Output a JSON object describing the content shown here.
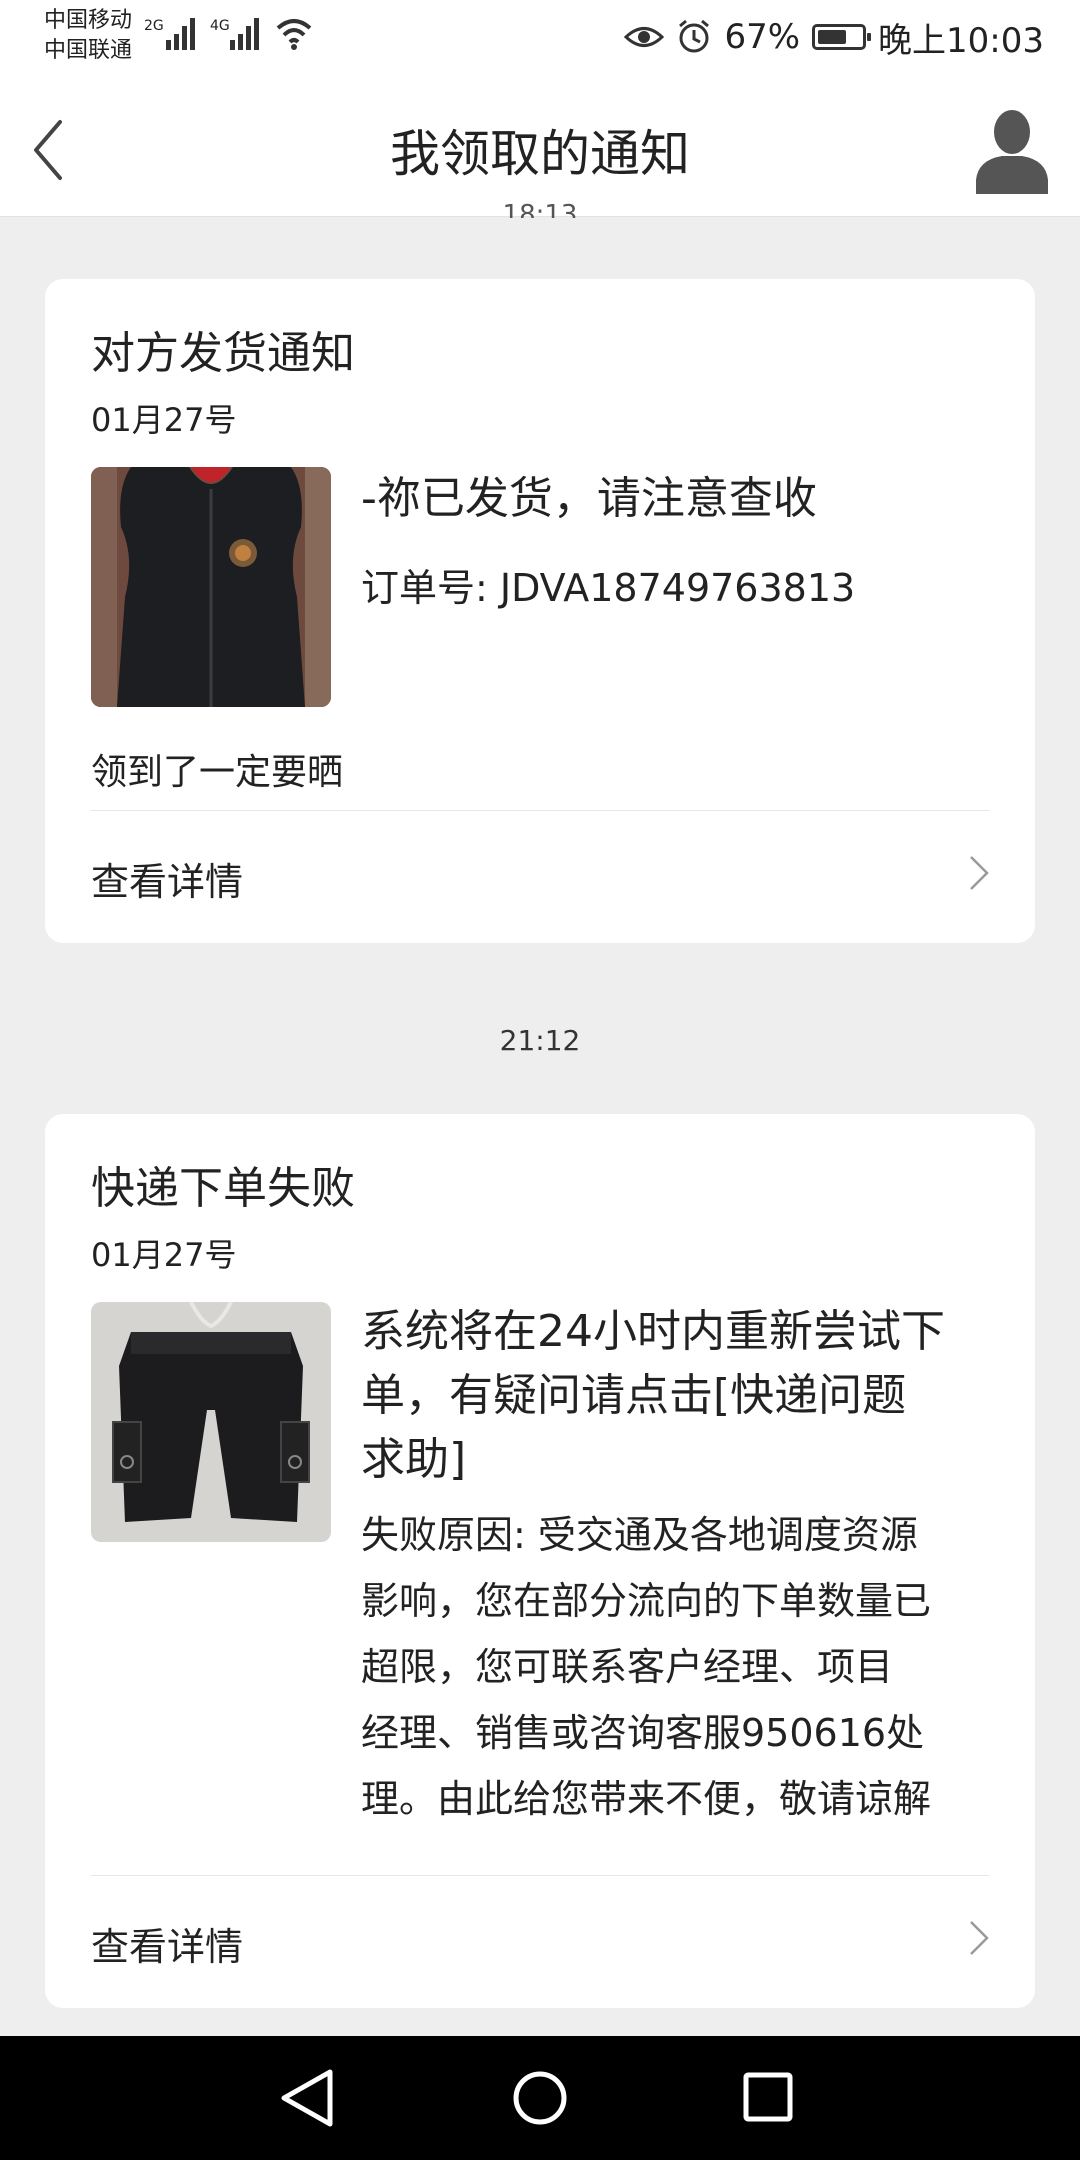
{
  "status": {
    "carrier1": "中国移动",
    "carrier2": "中国联通",
    "net1": "2G",
    "net2": "4G",
    "battery_percent": "67%",
    "battery_level": 0.67,
    "time": "晚上10:03"
  },
  "header": {
    "title": "我领取的通知",
    "back_icon": "chevron-left-icon",
    "avatar_icon": "user-icon"
  },
  "clipped_time": "18:13",
  "cards": [
    {
      "title": "对方发货通知",
      "date": "01月27号",
      "thumbnail": "black-vest-image",
      "message": "-祢已发货，请注意查收",
      "order_no": "订单号: JDVA18749763813",
      "remark": "领到了一定要晒",
      "detail_label": "查看详情"
    },
    {
      "title": "快递下单失败",
      "date": "01月27号",
      "thumbnail": "black-shorts-image",
      "message_lines": [
        "系统将在24小时内重新尝试下",
        "单，有疑问请点击[快递问题",
        "求助]"
      ],
      "reason_lines": [
        "失败原因: 受交通及各地调度资源",
        "影响，您在部分流向的下单数量已",
        "超限，您可联系客户经理、项目",
        "经理、销售或咨询客服950616处",
        "理。由此给您带来不便，敬请谅解"
      ],
      "detail_label": "查看详情"
    }
  ],
  "time_separator": "21:12",
  "navbar": {
    "back": "triangle-back-icon",
    "home": "circle-home-icon",
    "recents": "square-recents-icon"
  }
}
